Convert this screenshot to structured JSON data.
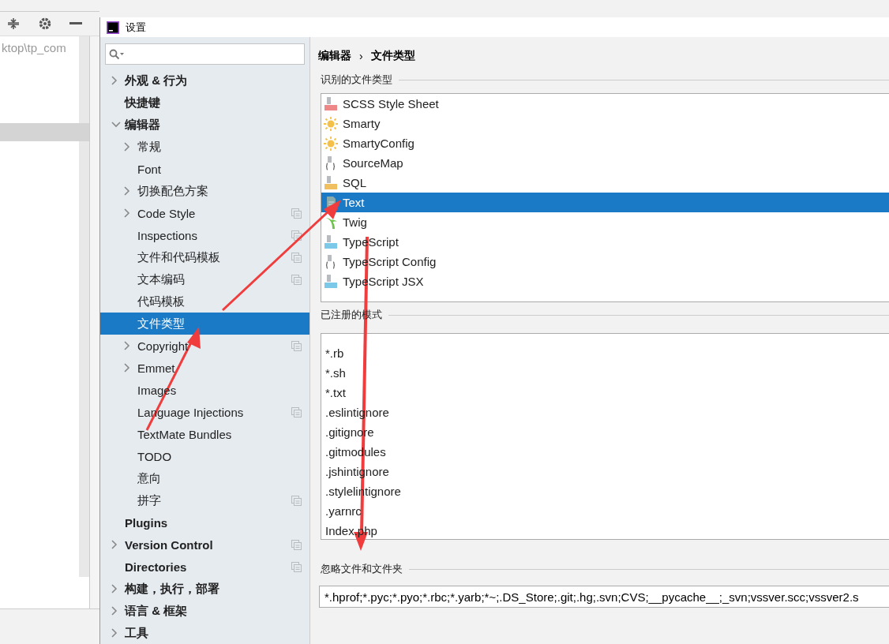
{
  "background_ide": {
    "path_text": "ktop\\tp_com"
  },
  "window": {
    "title": "设置"
  },
  "sidebar": {
    "items": [
      {
        "label": "外观 & 行为",
        "expandable": true,
        "expanded": false,
        "selected": false,
        "project_level": false
      },
      {
        "label": "快捷键",
        "expandable": false,
        "selected": false,
        "project_level": false
      },
      {
        "label": "编辑器",
        "expandable": true,
        "expanded": true,
        "selected": false,
        "project_level": false,
        "children": [
          {
            "label": "常规",
            "expandable": true,
            "expanded": false,
            "selected": false,
            "project_level": false
          },
          {
            "label": "Font",
            "expandable": false,
            "selected": false,
            "project_level": false
          },
          {
            "label": "切换配色方案",
            "expandable": true,
            "expanded": false,
            "selected": false,
            "project_level": false
          },
          {
            "label": "Code Style",
            "expandable": true,
            "expanded": false,
            "selected": false,
            "project_level": true
          },
          {
            "label": "Inspections",
            "expandable": false,
            "selected": false,
            "project_level": true
          },
          {
            "label": "文件和代码模板",
            "expandable": false,
            "selected": false,
            "project_level": true
          },
          {
            "label": "文本编码",
            "expandable": false,
            "selected": false,
            "project_level": true
          },
          {
            "label": "代码模板",
            "expandable": false,
            "selected": false,
            "project_level": false
          },
          {
            "label": "文件类型",
            "expandable": false,
            "selected": true,
            "project_level": false
          },
          {
            "label": "Copyright",
            "expandable": true,
            "expanded": false,
            "selected": false,
            "project_level": true
          },
          {
            "label": "Emmet",
            "expandable": true,
            "expanded": false,
            "selected": false,
            "project_level": false
          },
          {
            "label": "Images",
            "expandable": false,
            "selected": false,
            "project_level": false
          },
          {
            "label": "Language Injections",
            "expandable": false,
            "selected": false,
            "project_level": true
          },
          {
            "label": "TextMate Bundles",
            "expandable": false,
            "selected": false,
            "project_level": false
          },
          {
            "label": "TODO",
            "expandable": false,
            "selected": false,
            "project_level": false
          },
          {
            "label": "意向",
            "expandable": false,
            "selected": false,
            "project_level": false
          },
          {
            "label": "拼字",
            "expandable": false,
            "selected": false,
            "project_level": true
          }
        ]
      },
      {
        "label": "Plugins",
        "expandable": false,
        "selected": false,
        "project_level": false
      },
      {
        "label": "Version Control",
        "expandable": true,
        "expanded": false,
        "selected": false,
        "project_level": true
      },
      {
        "label": "Directories",
        "expandable": false,
        "selected": false,
        "project_level": true
      },
      {
        "label": "构建，执行，部署",
        "expandable": true,
        "expanded": false,
        "selected": false,
        "project_level": false
      },
      {
        "label": "语言 & 框架",
        "expandable": true,
        "expanded": false,
        "selected": false,
        "project_level": false
      },
      {
        "label": "工具",
        "expandable": true,
        "expanded": false,
        "selected": false,
        "project_level": false
      }
    ]
  },
  "breadcrumb": [
    "编辑器",
    "›",
    "文件类型"
  ],
  "recognized_file_types": {
    "title": "识别的文件类型",
    "items": [
      {
        "label": "SCSS Style Sheet",
        "kind": "sass",
        "selected": false
      },
      {
        "label": "Smarty",
        "kind": "smarty",
        "selected": false
      },
      {
        "label": "SmartyConfig",
        "kind": "smarty",
        "selected": false
      },
      {
        "label": "SourceMap",
        "kind": "braces",
        "selected": false
      },
      {
        "label": "SQL",
        "kind": "sql",
        "selected": false
      },
      {
        "label": "Text",
        "kind": "text",
        "selected": true
      },
      {
        "label": "Twig",
        "kind": "twig",
        "selected": false
      },
      {
        "label": "TypeScript",
        "kind": "ts",
        "selected": false
      },
      {
        "label": "TypeScript Config",
        "kind": "braces",
        "selected": false
      },
      {
        "label": "TypeScript JSX",
        "kind": "tsx",
        "selected": false
      }
    ]
  },
  "registered_patterns": {
    "title": "已注册的模式",
    "items": [
      {
        "label": "*.rb",
        "selected": false
      },
      {
        "label": "*.sh",
        "selected": false
      },
      {
        "label": "*.txt",
        "selected": false
      },
      {
        "label": ".eslintignore",
        "selected": false
      },
      {
        "label": ".gitignore",
        "selected": false
      },
      {
        "label": ".gitmodules",
        "selected": false
      },
      {
        "label": ".jshintignore",
        "selected": false
      },
      {
        "label": ".stylelintignore",
        "selected": false
      },
      {
        "label": ".yarnrc",
        "selected": false
      },
      {
        "label": "Index.php",
        "selected": false
      }
    ]
  },
  "ignore_files": {
    "title": "忽略文件和文件夹",
    "value": "*.hprof;*.pyc;*.pyo;*.rbc;*.yarb;*~;.DS_Store;.git;.hg;.svn;CVS;__pycache__;_svn;vssver.scc;vssver2.s"
  }
}
